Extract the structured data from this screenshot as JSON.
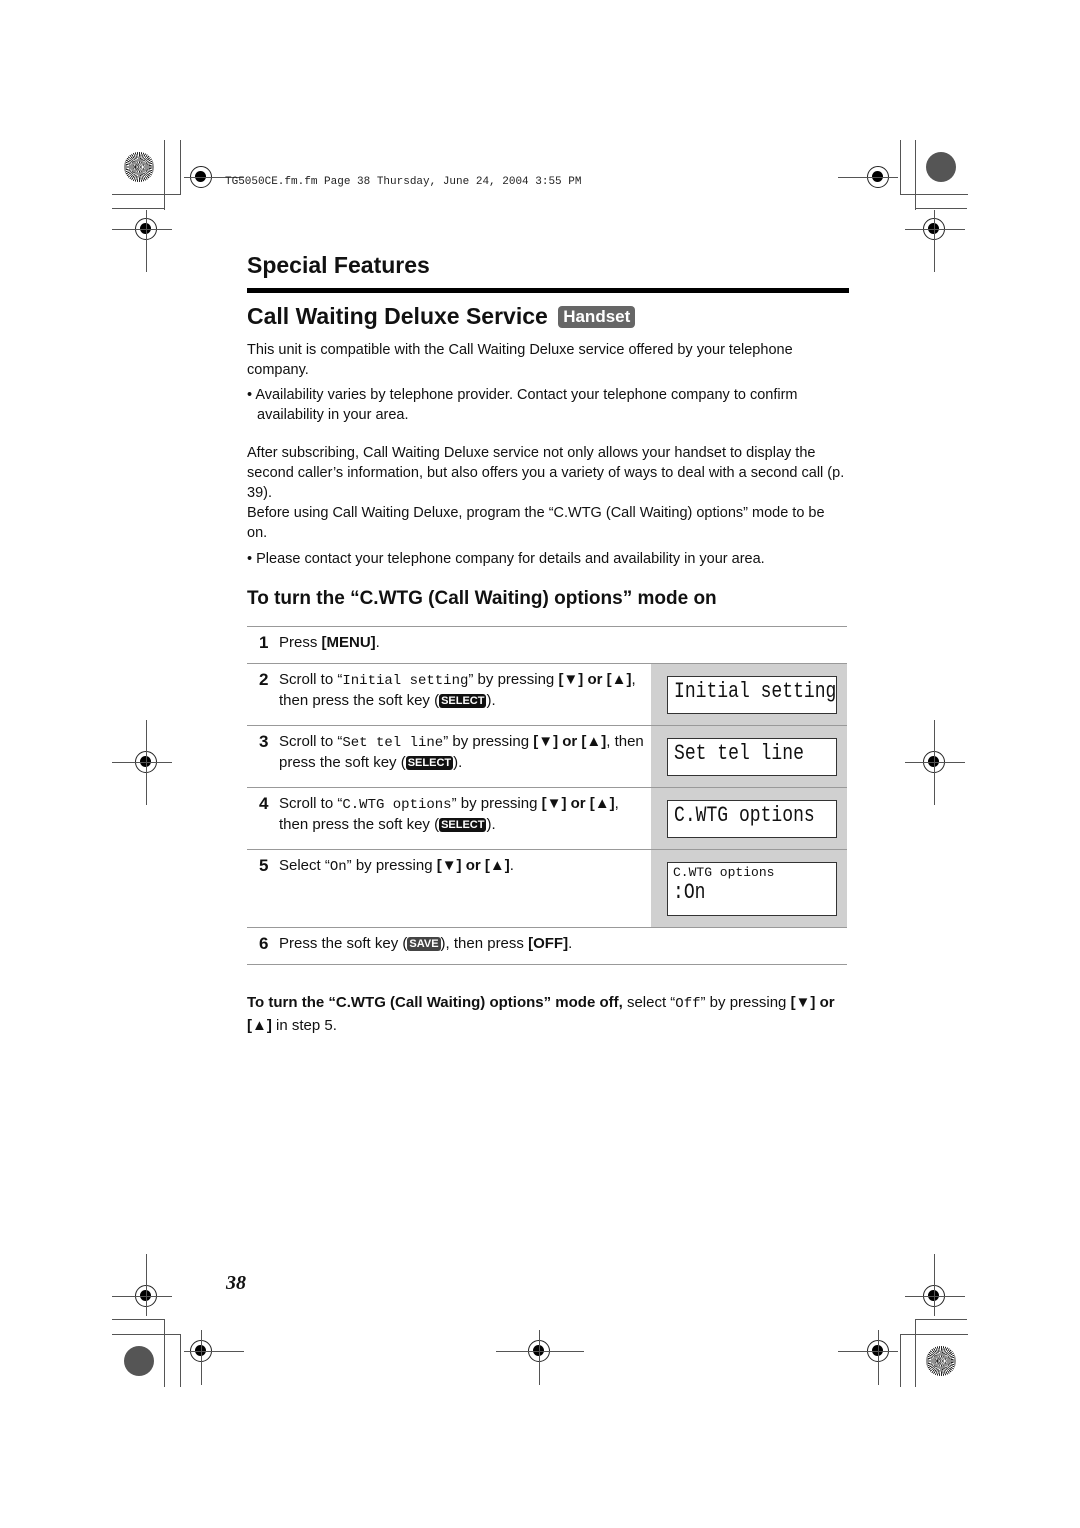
{
  "print_header": "TG5050CE.fm.fm  Page 38  Thursday, June 24, 2004  3:55 PM",
  "section_title": "Special Features",
  "page_title": "Call Waiting Deluxe Service",
  "badge": "Handset",
  "intro": "This unit is compatible with the Call Waiting Deluxe service offered by your telephone company.",
  "bullet1": "Availability varies by telephone provider. Contact your telephone company to confirm availability in your area.",
  "para2": "After subscribing, Call Waiting Deluxe service not only allows your handset to display the second caller’s information, but also offers you a variety of ways to deal with a second call (p. 39).",
  "para3": "Before using Call Waiting Deluxe, program the “C.WTG (Call Waiting) options” mode to be on.",
  "bullet2": "Please contact your telephone company for details and availability in your area.",
  "subheading": "To turn the “C.WTG (Call Waiting) options” mode on",
  "softkeys": {
    "select": "SELECT",
    "save": "SAVE"
  },
  "steps": [
    {
      "num": "1",
      "pre": "Press ",
      "key": "[MENU]",
      "post": "."
    },
    {
      "num": "2",
      "pre": "Scroll to “",
      "mono": "Initial setting",
      "mid": "” by pressing ",
      "keys": "[▼] or [▲]",
      "post": ", then press the soft key (",
      "end": ").",
      "lcd": "Initial setting"
    },
    {
      "num": "3",
      "pre": "Scroll to “",
      "mono": "Set tel line",
      "mid": "” by pressing ",
      "keys": "[▼] or [▲]",
      "post": ", then press the soft key (",
      "end": ").",
      "lcd": "Set tel line"
    },
    {
      "num": "4",
      "pre": "Scroll to “",
      "mono": "C.WTG options",
      "mid": "” by pressing ",
      "keys": "[▼] or [▲]",
      "post": ", then press the soft key (",
      "end": ").",
      "lcd": "C.WTG options"
    },
    {
      "num": "5",
      "pre": "Select “",
      "mono": "On",
      "mid": "” by pressing ",
      "keys": "[▼] or [▲]",
      "post": ".",
      "lcd_line1": "C.WTG options",
      "lcd_line2": ":On"
    },
    {
      "num": "6",
      "pre": "Press the soft key (",
      "mid": "), then press ",
      "key": "[OFF]",
      "post": "."
    }
  ],
  "off_note": {
    "bold": "To turn the “C.WTG (Call Waiting) options” mode off,",
    "pre": " select “",
    "mono": "Off",
    "post": "” by pressing ",
    "keys": "[▼] or [▲]",
    "end": " in step 5."
  },
  "page_number": "38"
}
